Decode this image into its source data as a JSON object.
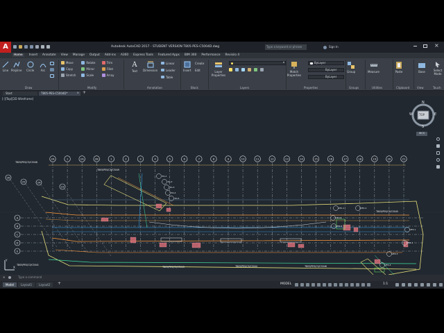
{
  "app": {
    "title": "Autodesk AutoCAD 2017 - STUDENT VERSION   T805-PES-C5004D.dwg",
    "search_placeholder": "Type a keyword or phrase",
    "signin": "Sign In",
    "logo": "A"
  },
  "menu_tabs": [
    "Home",
    "Insert",
    "Annotate",
    "View",
    "Manage",
    "Output",
    "Add-ins",
    "A360",
    "Express Tools",
    "Featured Apps",
    "BIM 360",
    "Performance",
    "Revisiio 4"
  ],
  "ribbon": {
    "draw": {
      "label": "Draw",
      "tools": [
        "Line",
        "Polyline",
        "Circle",
        "Arc"
      ]
    },
    "modify": {
      "label": "Modify",
      "tools": [
        "Move",
        "Rotate",
        "Trim",
        "Copy",
        "Mirror",
        "Fillet",
        "Stretch",
        "Scale",
        "Array"
      ]
    },
    "annotation": {
      "label": "Annotation",
      "tools": [
        "Text",
        "Dimension",
        "Linear",
        "Leader",
        "Table"
      ]
    },
    "block": {
      "label": "Block",
      "tools": [
        "Insert",
        "Create",
        "Edit"
      ]
    },
    "layers": {
      "label": "Layers",
      "tools": [
        "Layer Properties"
      ]
    },
    "properties": {
      "label": "Properties",
      "tools": [
        "Match Properties"
      ],
      "bylayer": [
        "ByLayer",
        "ByLayer",
        "ByLayer"
      ]
    },
    "groups": {
      "label": "Groups",
      "tools": [
        "Group"
      ]
    },
    "utilities": {
      "label": "Utilities",
      "tools": [
        "Measure"
      ]
    },
    "clipboard": {
      "label": "Clipboard",
      "tools": [
        "Paste"
      ]
    },
    "view": {
      "label": "View",
      "tools": [
        "Base"
      ]
    },
    "touch": {
      "label": "Touch",
      "tools": [
        "Select Mode"
      ]
    }
  },
  "doc_tabs": [
    "Start",
    "T805-PES-C5004D*"
  ],
  "viewport_label": "[-][Top][2D Wireframe]",
  "viewcube": {
    "top": "TOP",
    "n": "N",
    "s": "S",
    "w": "W",
    "e": "E",
    "wcs": "WCS"
  },
  "drawing": {
    "grid_top": [
      "2A",
      "1",
      "2A",
      "2B",
      "1",
      "2",
      "3",
      "4",
      "5",
      "6",
      "7",
      "8",
      "9",
      "10",
      "11",
      "12",
      "13",
      "14",
      "15",
      "16",
      "17",
      "18",
      "19",
      "20",
      "21"
    ],
    "grid_side": [
      "A",
      "B",
      "C",
      "D",
      "E"
    ],
    "left_bubbles": [
      "26",
      "25",
      "24",
      "23"
    ],
    "refs": [
      "T805/PES/C5/C5048",
      "T805/PES/C5/C5049",
      "T805/PES/C5/C5041",
      "T805/PES/C5/C5042",
      "T805/PES/C5/C5050",
      "T805/PES/C5/C5043",
      "T805/PES/C5/C5044",
      "T805/PES/C5/C5046",
      "T805/PES/C5/C5045",
      "T805/PES/C5/C5047"
    ],
    "tags": [
      "EA-1",
      "EA-2",
      "EA-3",
      "EA-4",
      "EA-5",
      "VE1-1",
      "VE2-2",
      "VE2-3",
      "VE2-4",
      "VE3-1",
      "VE3-2",
      "VE3-3",
      "VE3-4"
    ]
  },
  "command": {
    "placeholder": "Type a command"
  },
  "layout_tabs": [
    "Model",
    "Layout1",
    "Layout2"
  ],
  "status": {
    "mode": "MODEL",
    "scale": "1:1"
  }
}
